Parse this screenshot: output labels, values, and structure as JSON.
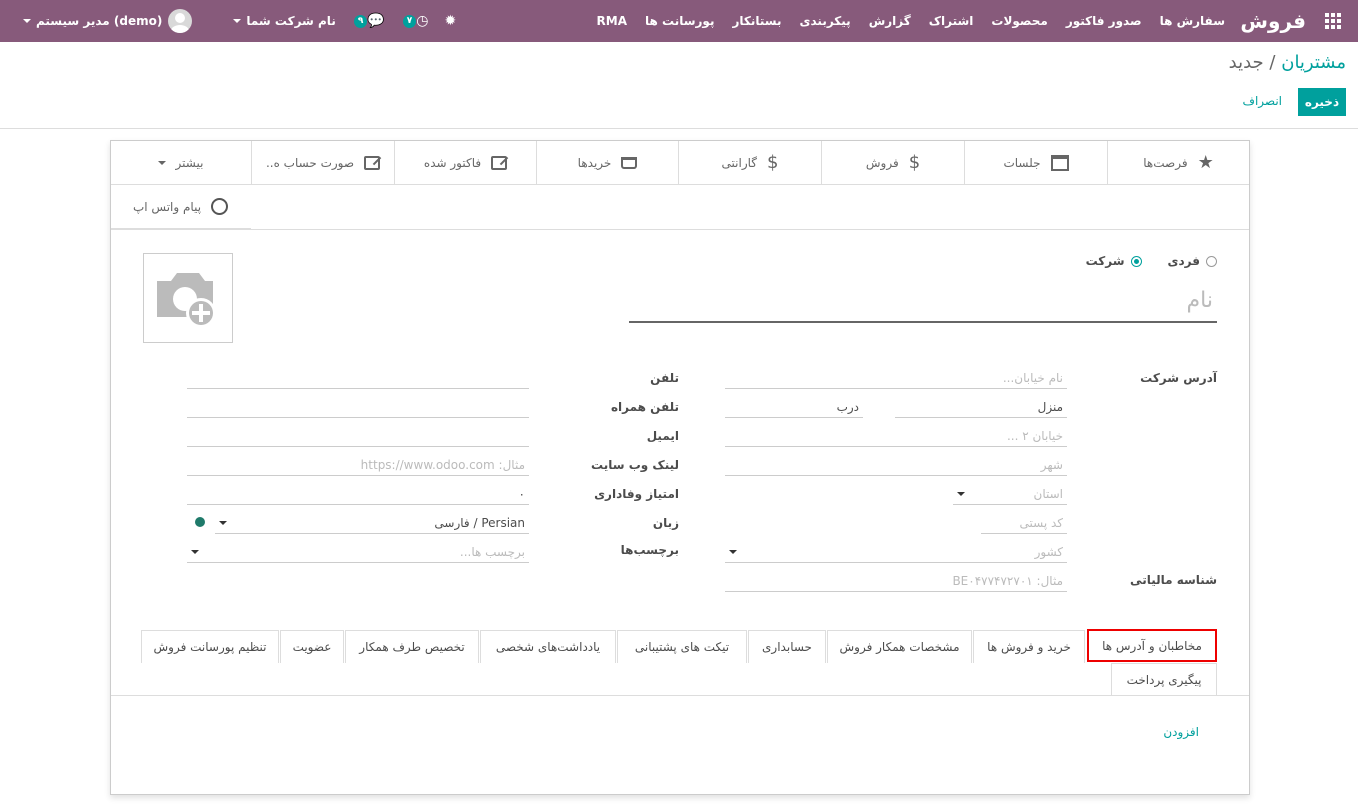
{
  "navbar": {
    "brand": "فروش",
    "menu": [
      "سفارش ها",
      "صدور فاکتور",
      "محصولات",
      "اشتراک",
      "گزارش",
      "پیکربندی",
      "بستانکار",
      "پورسانت ها",
      "RMA"
    ],
    "user": "مدیر سیستم (demo)",
    "company": "نام شرکت شما",
    "chat_count": "۹",
    "activity_count": "۷",
    "colors": {
      "navbar": "#875a7b",
      "accent": "#00a09d"
    }
  },
  "breadcrumb": {
    "parent": "مشتریان",
    "separator": "/",
    "current": "جدید"
  },
  "buttons": {
    "save": "ذخیره",
    "discard": "انصراف"
  },
  "smart_buttons": [
    {
      "label": "فرصت‌ها",
      "icon": "star-icon"
    },
    {
      "label": "جلسات",
      "icon": "calendar-icon"
    },
    {
      "label": "فروش",
      "icon": "dollar-icon"
    },
    {
      "label": "گارانتی",
      "icon": "dollar-icon"
    },
    {
      "label": "خریدها",
      "icon": "cart-icon"
    },
    {
      "label": "فاکتور شده",
      "icon": "edit-icon"
    },
    {
      "label": "صورت حساب ه..",
      "icon": "edit-icon"
    },
    {
      "label": "بیشتر",
      "icon": "chevron-down-icon"
    },
    {
      "label": "پیام واتس اپ",
      "icon": "whatsapp-icon"
    }
  ],
  "form": {
    "type_options": [
      "فردی",
      "شرکت"
    ],
    "type_selected": "شرکت",
    "name_placeholder": "نام",
    "address_label": "آدرس شرکت",
    "street_placeholder": "نام خیابان...",
    "house_label": "منزل",
    "door_label": "درب",
    "street2_placeholder": "خیابان ۲ ...",
    "city_placeholder": "شهر",
    "state_placeholder": "استان",
    "zip_placeholder": "کد پستی",
    "country_placeholder": "کشور",
    "vat_label": "شناسه مالیاتی",
    "vat_placeholder": "مثال: BE۰۴۷۷۴۷۲۷۰۱",
    "phone_label": "تلفن",
    "mobile_label": "تلفن همراه",
    "email_label": "ایمیل",
    "website_label": "لینک وب سایت",
    "website_placeholder": "مثال: https://www.odoo.com",
    "loyalty_label": "امتیاز وفاداری",
    "loyalty_value": "۰",
    "lang_label": "زبان",
    "lang_value": "Persian / فارسی",
    "tags_label": "برچسب‌ها",
    "tags_placeholder": "برچسب ها..."
  },
  "tabs": [
    "مخاطبان و آدرس ها",
    "خرید و فروش ها",
    "مشخصات همکار فروش",
    "حسابداری",
    "تیکت های پشتیبانی",
    "یادداشت‌های شخصی",
    "تخصیص طرف همکار",
    "عضویت",
    "تنظیم پورسانت فروش",
    "پیگیری پرداخت"
  ],
  "active_tab": "مخاطبان و آدرس ها",
  "add_line": "افزودن"
}
